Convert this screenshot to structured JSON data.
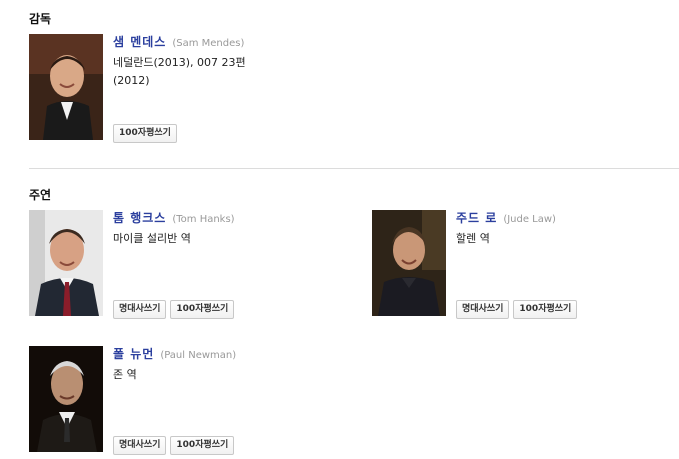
{
  "director_section": {
    "title": "감독",
    "people": [
      {
        "name_kr": "샘 멘데스",
        "name_en": "(Sam Mendes)",
        "role": "네덜란드(2013), 007 23편 (2012)",
        "buttons": [
          "100자평쓰기"
        ]
      }
    ]
  },
  "cast_section": {
    "title": "주연",
    "people": [
      {
        "name_kr": "톰 행크스",
        "name_en": "(Tom Hanks)",
        "role": "마이클 설리반 역",
        "buttons": [
          "명대사쓰기",
          "100자평쓰기"
        ]
      },
      {
        "name_kr": "주드 로",
        "name_en": "(Jude Law)",
        "role": "할렌 역",
        "buttons": [
          "명대사쓰기",
          "100자평쓰기"
        ]
      },
      {
        "name_kr": "폴 뉴먼",
        "name_en": "(Paul Newman)",
        "role": "존 역",
        "buttons": [
          "명대사쓰기",
          "100자평쓰기"
        ]
      }
    ]
  },
  "colors": {
    "name_link": "#2b3f9e",
    "english_name": "#999999",
    "divider": "#dcdcdc"
  }
}
